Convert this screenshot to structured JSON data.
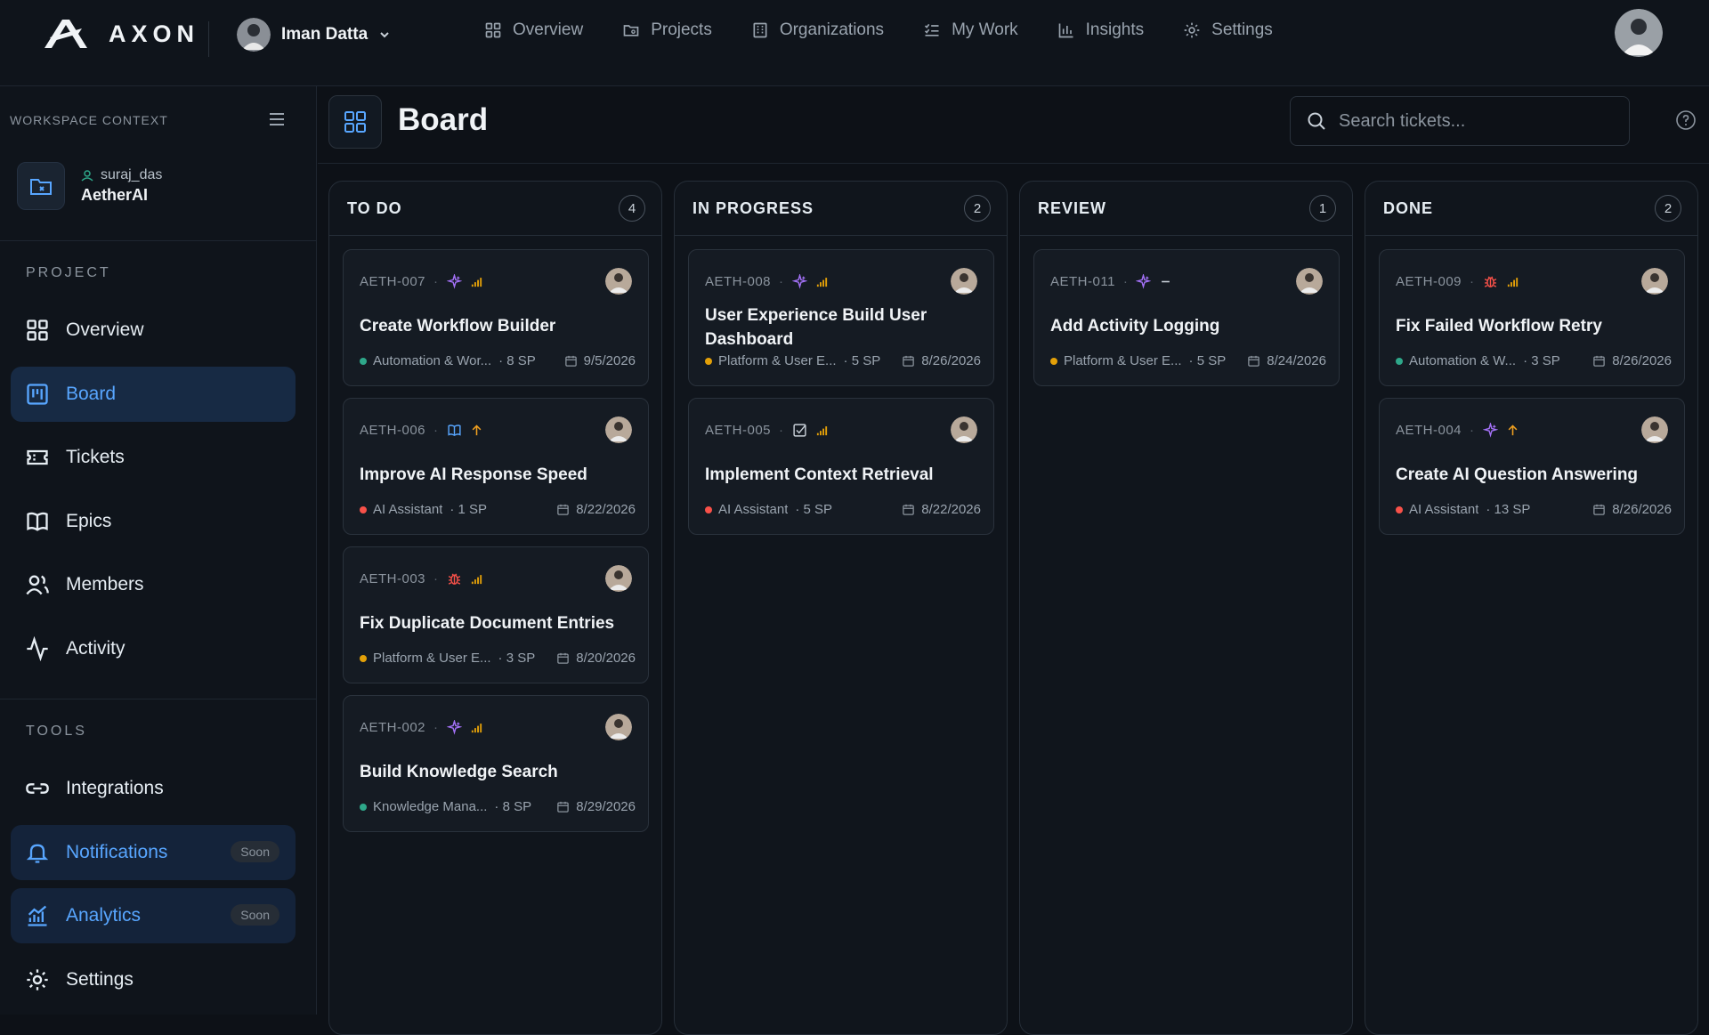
{
  "app": {
    "brand": "AXON",
    "user": "Iman Datta"
  },
  "nav": [
    {
      "label": "Overview",
      "icon": "grid-icon"
    },
    {
      "label": "Projects",
      "icon": "folder-icon"
    },
    {
      "label": "Organizations",
      "icon": "building-icon"
    },
    {
      "label": "My Work",
      "icon": "checklist-icon"
    },
    {
      "label": "Insights",
      "icon": "bar-chart-icon"
    },
    {
      "label": "Settings",
      "icon": "gear-icon"
    }
  ],
  "sidebar": {
    "workspace_label": "WORKSPACE CONTEXT",
    "workspace_user": "suraj_das",
    "workspace_name": "AetherAI",
    "project_label": "PROJECT",
    "tools_label": "TOOLS",
    "project_items": [
      {
        "label": "Overview",
        "icon": "grid-icon"
      },
      {
        "label": "Board",
        "icon": "kanban-icon",
        "active": true
      },
      {
        "label": "Tickets",
        "icon": "ticket-icon"
      },
      {
        "label": "Epics",
        "icon": "book-icon"
      },
      {
        "label": "Members",
        "icon": "users-icon"
      },
      {
        "label": "Activity",
        "icon": "activity-icon"
      }
    ],
    "tool_items": [
      {
        "label": "Integrations",
        "icon": "link-icon"
      },
      {
        "label": "Notifications",
        "icon": "bell-icon",
        "badge": "Soon"
      },
      {
        "label": "Analytics",
        "icon": "line-chart-icon",
        "badge": "Soon"
      },
      {
        "label": "Settings",
        "icon": "gear-icon"
      }
    ]
  },
  "page": {
    "title": "Board",
    "search_placeholder": "Search tickets..."
  },
  "colors": {
    "accent": "#58a6ff",
    "feature": "#a371f7",
    "bug": "#f85149",
    "story": "#58a6ff",
    "task": "#c9d1d9",
    "priority_bars": "#e3a008",
    "priority_up": "#f0a020",
    "epic_automation": "#2ea88a",
    "epic_platform": "#e3a008",
    "epic_ai": "#f85149",
    "epic_knowledge": "#2ea88a"
  },
  "columns": [
    {
      "title": "TO DO",
      "count": "4",
      "cards": [
        {
          "id": "AETH-007",
          "type": "feature-icon",
          "priority": "priority-bars-icon",
          "title": "Create Workflow Builder",
          "epic": "Automation & Wor...",
          "epic_color": "#2ea88a",
          "sp": "· 8 SP",
          "date": "9/5/2026"
        },
        {
          "id": "AETH-006",
          "type": "book-icon",
          "priority": "priority-up-icon",
          "title": "Improve AI Response Speed",
          "epic": "AI Assistant",
          "epic_color": "#f85149",
          "sp": "· 1 SP",
          "date": "8/22/2026"
        },
        {
          "id": "AETH-003",
          "type": "bug-icon",
          "priority": "priority-bars-icon",
          "title": "Fix Duplicate Document Entries",
          "epic": "Platform & User E...",
          "epic_color": "#e3a008",
          "sp": "· 3 SP",
          "date": "8/20/2026"
        },
        {
          "id": "AETH-002",
          "type": "feature-icon",
          "priority": "priority-bars-icon",
          "title": "Build Knowledge Search",
          "epic": "Knowledge Mana...",
          "epic_color": "#2ea88a",
          "sp": "· 8 SP",
          "date": "8/29/2026"
        }
      ]
    },
    {
      "title": "IN PROGRESS",
      "count": "2",
      "cards": [
        {
          "id": "AETH-008",
          "type": "feature-icon",
          "priority": "priority-bars-icon",
          "title": "User Experience Build User Dashboard",
          "epic": "Platform & User E...",
          "epic_color": "#e3a008",
          "sp": "· 5 SP",
          "date": "8/26/2026"
        },
        {
          "id": "AETH-005",
          "type": "task-check-icon",
          "priority": "priority-bars-icon",
          "title": "Implement Context Retrieval",
          "epic": "AI Assistant",
          "epic_color": "#f85149",
          "sp": "· 5 SP",
          "date": "8/22/2026"
        }
      ]
    },
    {
      "title": "REVIEW",
      "count": "1",
      "cards": [
        {
          "id": "AETH-011",
          "type": "feature-icon",
          "priority": "priority-dash-icon",
          "title": "Add Activity Logging",
          "epic": "Platform & User E...",
          "epic_color": "#e3a008",
          "sp": "· 5 SP",
          "date": "8/24/2026"
        }
      ]
    },
    {
      "title": "DONE",
      "count": "2",
      "cards": [
        {
          "id": "AETH-009",
          "type": "bug-icon",
          "priority": "priority-bars-icon",
          "title": "Fix Failed Workflow Retry",
          "epic": "Automation & W...",
          "epic_color": "#2ea88a",
          "sp": "· 3 SP",
          "date": "8/26/2026"
        },
        {
          "id": "AETH-004",
          "type": "feature-icon",
          "priority": "priority-up-icon",
          "title": "Create AI Question Answering",
          "epic": "AI Assistant",
          "epic_color": "#f85149",
          "sp": "· 13 SP",
          "date": "8/26/2026"
        }
      ]
    }
  ]
}
